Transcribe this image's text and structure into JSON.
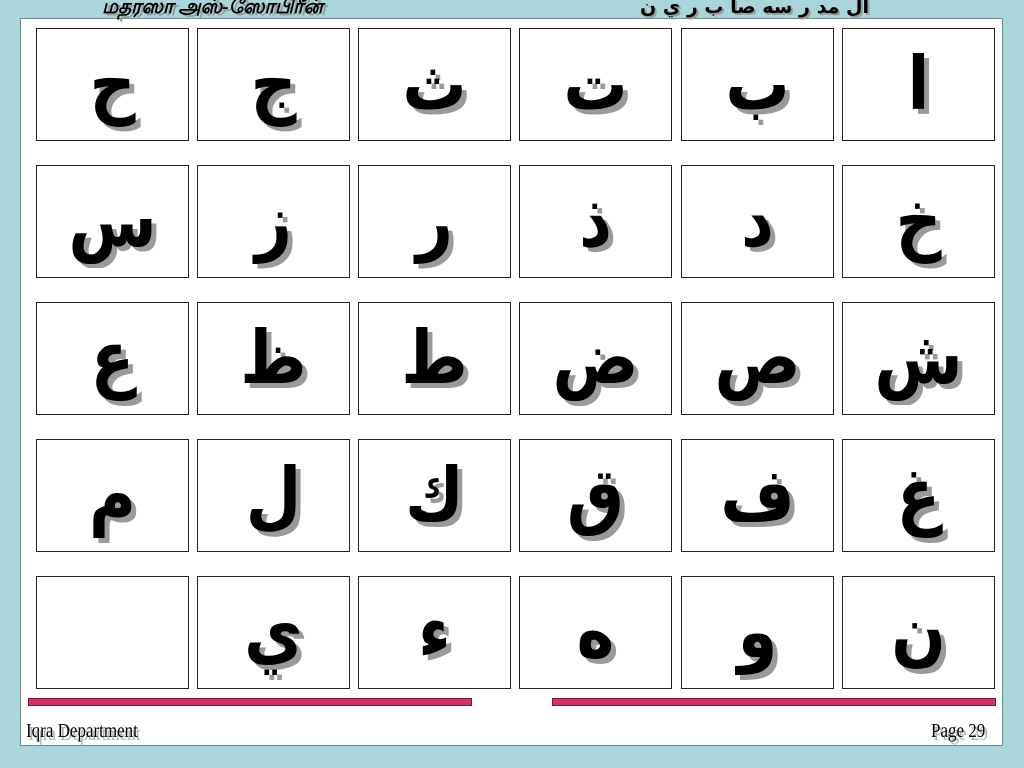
{
  "header": {
    "tamil_title": "மதரஸா அஸ்-ஸோபிரீன்",
    "arabic_title": "ال مد ر سه صا ب ر ي ن"
  },
  "letters": [
    "ا",
    "ب",
    "ت",
    "ث",
    "ج",
    "ح",
    "خ",
    "د",
    "ذ",
    "ر",
    "ز",
    "س",
    "ش",
    "ص",
    "ض",
    "ط",
    "ظ",
    "ع",
    "غ",
    "ف",
    "ق",
    "ك",
    "ل",
    "م",
    "ن",
    "و",
    "ه",
    "ء",
    "ي",
    ""
  ],
  "footer": {
    "department": "Iqra Department",
    "page": "Page 29"
  },
  "colors": {
    "background": "#a9d5db",
    "bar": "#d4306e"
  }
}
